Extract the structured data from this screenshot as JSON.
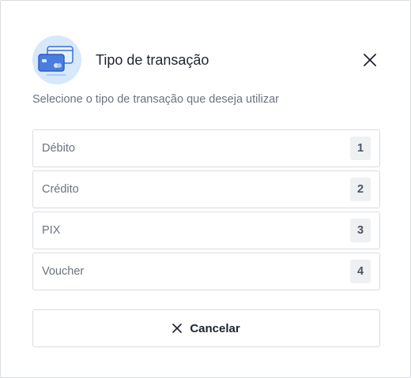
{
  "dialog": {
    "title": "Tipo de transação",
    "subtitle": "Selecione o tipo de transação que deseja utilizar",
    "header_icon": "credit-cards-icon",
    "close_icon": "close-icon"
  },
  "options": [
    {
      "label": "Débito",
      "key": "1"
    },
    {
      "label": "Crédito",
      "key": "2"
    },
    {
      "label": "PIX",
      "key": "3"
    },
    {
      "label": "Voucher",
      "key": "4"
    }
  ],
  "cancel": {
    "label": "Cancelar",
    "icon": "close-icon"
  },
  "colors": {
    "icon_background": "#d7e8fb",
    "card_blue": "#3b6fd8",
    "border": "#d9dce1",
    "key_background": "#eef0f2"
  }
}
